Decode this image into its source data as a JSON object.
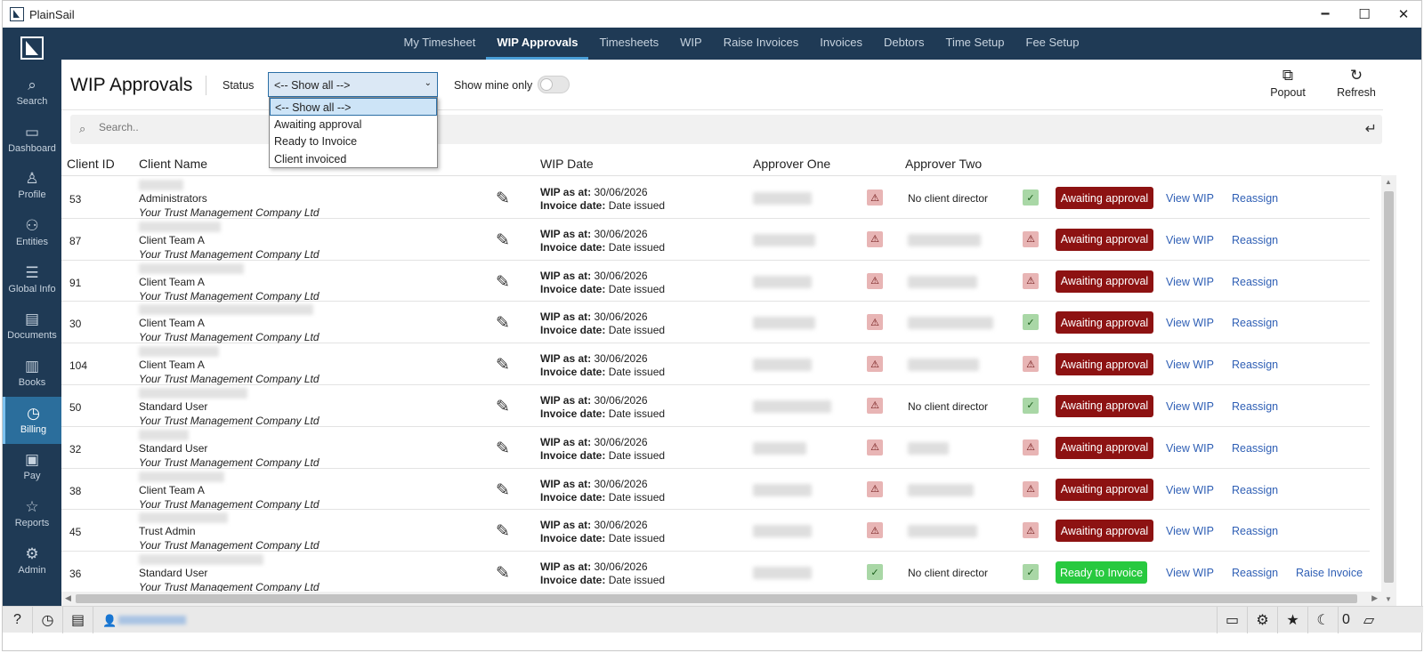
{
  "window": {
    "title": "PlainSail",
    "minimize": "🗕",
    "maximize": "☐",
    "close": "✕"
  },
  "nav": {
    "items": [
      {
        "label": "My Timesheet",
        "active": false
      },
      {
        "label": "WIP Approvals",
        "active": true
      },
      {
        "label": "Timesheets",
        "active": false
      },
      {
        "label": "WIP",
        "active": false
      },
      {
        "label": "Raise Invoices",
        "active": false
      },
      {
        "label": "Invoices",
        "active": false
      },
      {
        "label": "Debtors",
        "active": false
      },
      {
        "label": "Time Setup",
        "active": false
      },
      {
        "label": "Fee Setup",
        "active": false
      }
    ]
  },
  "sidebar": {
    "items": [
      {
        "label": "Search",
        "icon": "search-icon",
        "glyph": "⌕",
        "active": false
      },
      {
        "label": "Dashboard",
        "icon": "monitor-icon",
        "glyph": "▭",
        "active": false
      },
      {
        "label": "Profile",
        "icon": "person-icon",
        "glyph": "♙",
        "active": false
      },
      {
        "label": "Entities",
        "icon": "people-icon",
        "glyph": "⚇",
        "active": false
      },
      {
        "label": "Global Info",
        "icon": "list-icon",
        "glyph": "☰",
        "active": false
      },
      {
        "label": "Documents",
        "icon": "folder-icon",
        "glyph": "▤",
        "active": false
      },
      {
        "label": "Books",
        "icon": "book-icon",
        "glyph": "▥",
        "active": false
      },
      {
        "label": "Billing",
        "icon": "clock-icon",
        "glyph": "◷",
        "active": true
      },
      {
        "label": "Pay",
        "icon": "money-icon",
        "glyph": "▣",
        "active": false
      },
      {
        "label": "Reports",
        "icon": "star-icon",
        "glyph": "☆",
        "active": false
      },
      {
        "label": "Admin",
        "icon": "admin-icon",
        "glyph": "⚙",
        "active": false
      }
    ]
  },
  "page": {
    "title": "WIP Approvals",
    "status_label": "Status",
    "status_value": "<-- Show all -->",
    "status_options": [
      "<-- Show all -->",
      "Awaiting approval",
      "Ready to Invoice",
      "Client invoiced"
    ],
    "show_mine_label": "Show mine only",
    "show_mine_on": false,
    "popout_label": "Popout",
    "refresh_label": "Refresh",
    "search_placeholder": "Search.."
  },
  "table": {
    "columns": [
      "Client ID",
      "Client Name",
      "WIP Date",
      "Approver One",
      "Approver Two"
    ],
    "wip_label": "WIP as at:",
    "invoice_label": "Invoice date:",
    "view_label": "View WIP",
    "reassign_label": "Reassign",
    "rows": [
      {
        "id": "53",
        "name": "Administrators",
        "company": "Your Trust Management Company Ltd",
        "wip_date": "30/06/2026",
        "invoice_date": "Date issued",
        "approver_one_status": "warn",
        "approver_two": "No client director",
        "approver_two_status": "ok",
        "status": "Awaiting approval",
        "raise": ""
      },
      {
        "id": "87",
        "name": "Client Team A",
        "company": "Your Trust Management Company Ltd",
        "wip_date": "30/06/2026",
        "invoice_date": "Date issued",
        "approver_one_status": "warn",
        "approver_two": "",
        "approver_two_status": "warn",
        "status": "Awaiting approval",
        "raise": ""
      },
      {
        "id": "91",
        "name": "Client Team A",
        "company": "Your Trust Management Company Ltd",
        "wip_date": "30/06/2026",
        "invoice_date": "Date issued",
        "approver_one_status": "warn",
        "approver_two": "",
        "approver_two_status": "warn",
        "status": "Awaiting approval",
        "raise": ""
      },
      {
        "id": "30",
        "name": "Client Team A",
        "company": "Your Trust Management Company Ltd",
        "wip_date": "30/06/2026",
        "invoice_date": "Date issued",
        "approver_one_status": "warn",
        "approver_two": "",
        "approver_two_status": "ok",
        "status": "Awaiting approval",
        "raise": ""
      },
      {
        "id": "104",
        "name": "Client Team A",
        "company": "Your Trust Management Company Ltd",
        "wip_date": "30/06/2026",
        "invoice_date": "Date issued",
        "approver_one_status": "warn",
        "approver_two": "",
        "approver_two_status": "warn",
        "status": "Awaiting approval",
        "raise": ""
      },
      {
        "id": "50",
        "name": "Standard User",
        "company": "Your Trust Management Company Ltd",
        "wip_date": "30/06/2026",
        "invoice_date": "Date issued",
        "approver_one_status": "warn",
        "approver_two": "No client director",
        "approver_two_status": "ok",
        "status": "Awaiting approval",
        "raise": ""
      },
      {
        "id": "32",
        "name": "Standard User",
        "company": "Your Trust Management Company Ltd",
        "wip_date": "30/06/2026",
        "invoice_date": "Date issued",
        "approver_one_status": "warn",
        "approver_two": "",
        "approver_two_status": "warn",
        "status": "Awaiting approval",
        "raise": ""
      },
      {
        "id": "38",
        "name": "Client Team A",
        "company": "Your Trust Management Company Ltd",
        "wip_date": "30/06/2026",
        "invoice_date": "Date issued",
        "approver_one_status": "warn",
        "approver_two": "",
        "approver_two_status": "warn",
        "status": "Awaiting approval",
        "raise": ""
      },
      {
        "id": "45",
        "name": "Trust Admin",
        "company": "Your Trust Management Company Ltd",
        "wip_date": "30/06/2026",
        "invoice_date": "Date issued",
        "approver_one_status": "warn",
        "approver_two": "",
        "approver_two_status": "warn",
        "status": "Awaiting approval",
        "raise": ""
      },
      {
        "id": "36",
        "name": "Standard User",
        "company": "Your Trust Management Company Ltd",
        "wip_date": "30/06/2026",
        "invoice_date": "Date issued",
        "approver_one_status": "ok",
        "approver_two": "No client director",
        "approver_two_status": "ok",
        "status": "Ready to Invoice",
        "raise": "Raise Invoice"
      }
    ]
  },
  "statusbar": {
    "notification_count": "0"
  },
  "colors": {
    "nav_bg": "#1f3a55",
    "active_side": "#2b6e9c",
    "await_badge": "#8d1212",
    "ready_badge": "#28c93f",
    "link": "#2f5fb5"
  }
}
